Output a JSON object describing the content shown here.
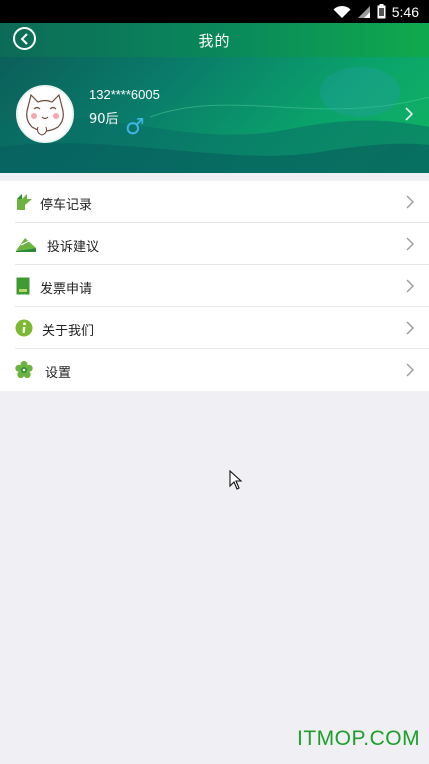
{
  "status_bar": {
    "time": "5:46",
    "icons": [
      "wifi-icon",
      "signal-icon",
      "battery-icon"
    ]
  },
  "header": {
    "title": "我的",
    "back_icon": "back-circle-icon"
  },
  "profile": {
    "phone": "132****6005",
    "age_group": "90后",
    "gender_symbol": "♂",
    "avatar_icon": "cartoon-cat-avatar"
  },
  "menu": {
    "items": [
      {
        "label": "停车记录",
        "icon": "parking-record-icon"
      },
      {
        "label": "投诉建议",
        "icon": "complaint-icon"
      },
      {
        "label": "发票申请",
        "icon": "invoice-icon"
      },
      {
        "label": "关于我们",
        "icon": "info-icon"
      },
      {
        "label": "设置",
        "icon": "settings-flower-icon"
      }
    ]
  },
  "watermark": "ITMOP.COM",
  "colors": {
    "header_green": "#0a8a5b",
    "icon_green": "#6cb33f",
    "watermark_green": "#1e9f2a",
    "background": "#efeff4"
  }
}
